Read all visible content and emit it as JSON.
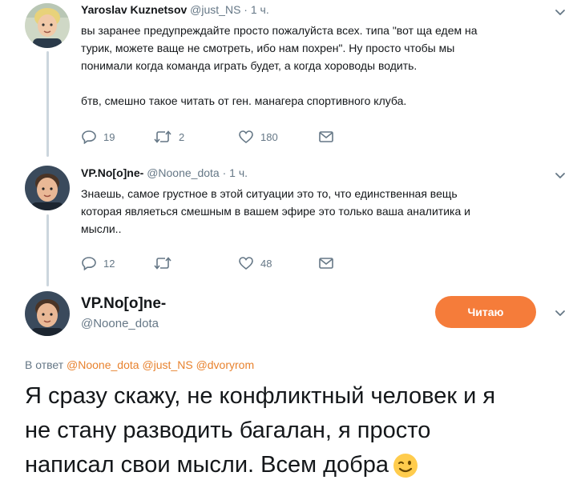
{
  "tweets": [
    {
      "name": "Yaroslav Kuznetsov",
      "handle": "@just_NS",
      "dot": "·",
      "time": "1 ч.",
      "lines": [
        "вы заранее предупреждайте просто пожалуйста всех. типа \"вот ща едем на",
        "турик, можете ваще не смотреть, ибо нам похрен\". Ну просто чтобы мы",
        "понимали когда команда играть будет, а когда хороводы водить.",
        "",
        "бтв, смешно такое читать от ген. манагера спортивного клуба."
      ],
      "replies": "19",
      "retweets": "2",
      "likes": "180"
    },
    {
      "name": "VP.No[o]ne-",
      "handle": "@Noone_dota",
      "dot": "·",
      "time": "1 ч.",
      "lines": [
        "Знаешь, самое грустное в этой ситуации это то, что единственная вещь",
        "которая являеться смешным в вашем эфире это только ваша аналитика и",
        "мысли.."
      ],
      "replies": "12",
      "retweets": "",
      "likes": "48"
    }
  ],
  "main": {
    "name": "VP.No[o]ne-",
    "handle": "@Noone_dota",
    "follow_label": "Читаю",
    "reply_prefix": "В ответ",
    "mentions": [
      "@Noone_dota",
      "@just_NS",
      "@dvoryrom"
    ],
    "text_lines": [
      "Я сразу скажу, не конфликтный человек и я",
      "не стану разводить багалан, я просто",
      "написал свои мысли. Всем добра"
    ],
    "emoji": "winking-face"
  },
  "colors": {
    "accent": "#f57c3a",
    "mention": "#e8822e",
    "muted": "#657786",
    "thread_line": "#ccd6dd"
  }
}
